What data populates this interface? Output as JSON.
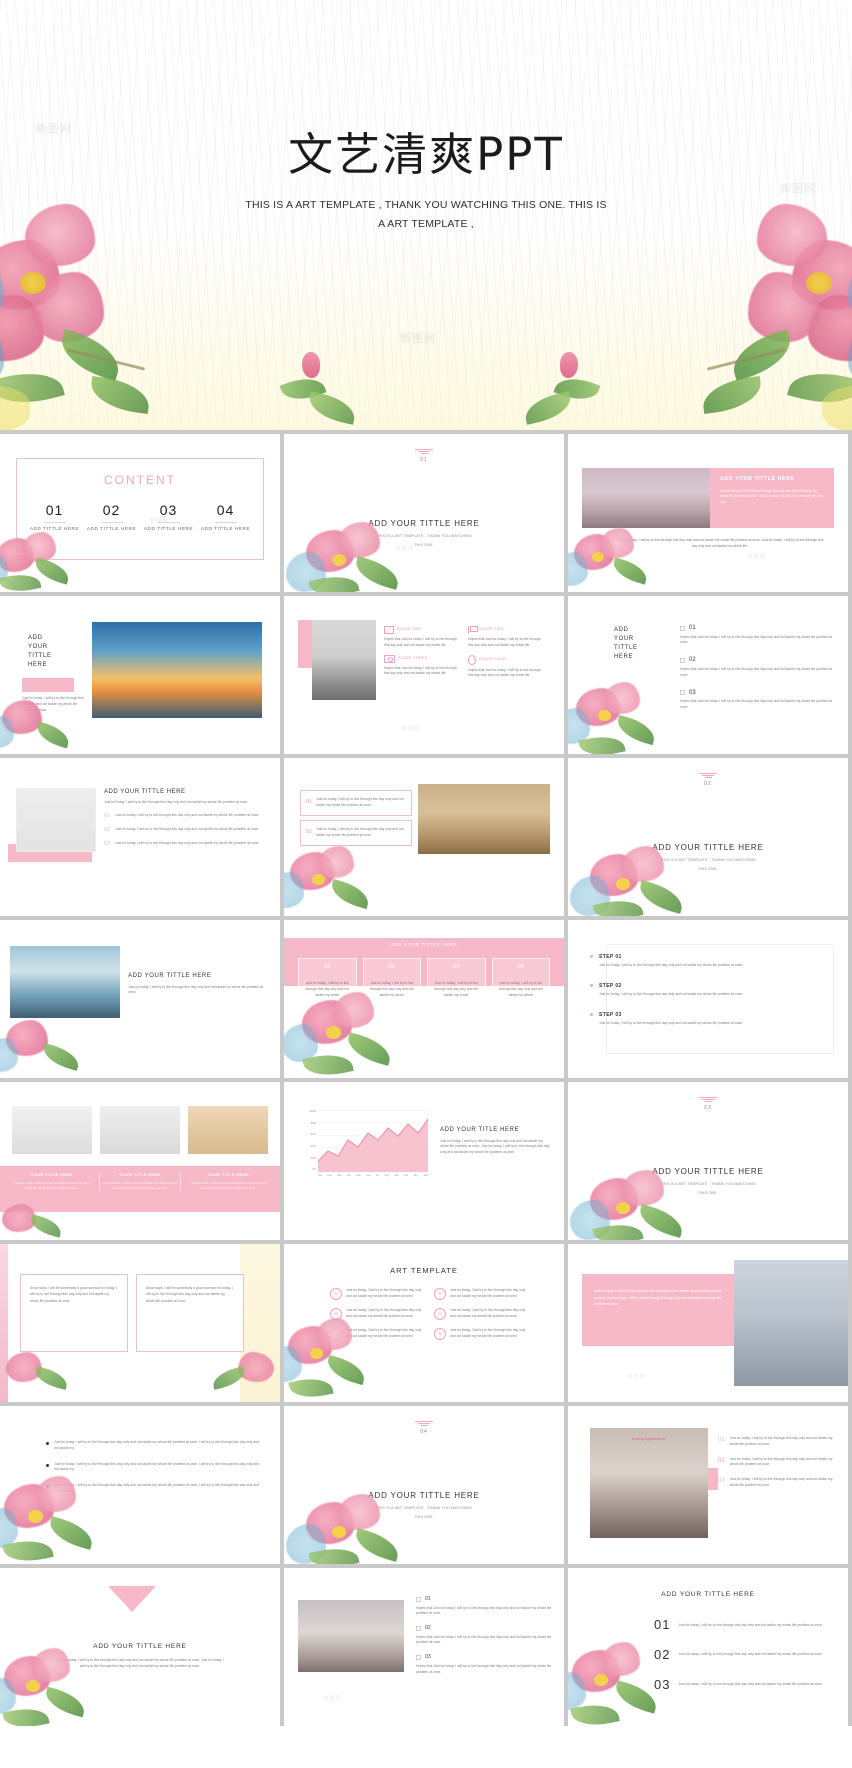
{
  "cover": {
    "title": "文艺清爽PPT",
    "subtitle_line1": "THIS IS A ART TEMPLATE , THANK YOU WATCHING THIS ONE. THIS IS",
    "subtitle_line2": "A ART TEMPLATE ,",
    "watermark": "新图网"
  },
  "common": {
    "body_short": "Just for today, I will try to live through this day only and not tackle my whole life problem at once.",
    "body_long": "Just for today, I will try to live through this day only and not tackle my whole life problem at once. Just for today, I will try to live through this day only and not tackle my whole life.",
    "body_tiny": "Just for today, I will try to live through this day only and not tackle my whole",
    "hope_text": "Hopes that Just for today, I will try to live through this day only and not tackle my whole life problem at once.",
    "title_default": "ADD  YOUR TITTLE HERE",
    "subtitle_default": "THIS IS A ART TEMPLATE ,  THANK YOU WATCHING THIS ONE",
    "add_title_here": "ADD TITTLE HERE",
    "accent_pink": "#f7b9c8",
    "accent_pink_text": "#f29ab0"
  },
  "slides": [
    {
      "id": "content-overview",
      "heading": "CONTENT",
      "numbers": [
        "01",
        "02",
        "03",
        "04"
      ],
      "labels": [
        "ADD TITTLE HERE",
        "ADD TITTLE HERE",
        "ADD TITTLE HERE",
        "ADD TITTLE HERE"
      ]
    },
    {
      "id": "section-01",
      "section_number": "01",
      "title": "ADD  YOUR TITTLE HERE",
      "subtitle_line1": "THIS IS A ART TEMPLATE ,  THANK YOU WATCHING",
      "subtitle_line2": "THIS ONE."
    },
    {
      "id": "photo-right-pink-panel",
      "panel_title": "ADD YOUR TITTLE HERE",
      "panel_body": "Just for today, I will try to live through this day only and not tackle my whole life problem at once. Just for today, I will try to live through this day only.",
      "caption": "Just for today, I will try to live through this day only and not tackle my whole life problem at once. Just for today, I will try to live through this day only and not tackle my whole life."
    },
    {
      "id": "photo-left-title",
      "title_lines": [
        "ADD",
        "YOUR",
        "TITTLE",
        "HERE"
      ],
      "body": "Just for today, I will try to live through this day only and not tackle my whole life problem at once."
    },
    {
      "id": "four-stage-icons",
      "stages": [
        {
          "label": "STAGE ONE",
          "icon": "envelope-icon",
          "body": "Hopes that Just for today, I will try to live through this day only and not tackle my whole life."
        },
        {
          "label": "STAGE TWO",
          "icon": "flag-icon",
          "body": "Hopes that Just for today, I will try to live through this day only and not tackle my whole life."
        },
        {
          "label": "STAGE THREE",
          "icon": "camera-icon",
          "body": "Hopes that Just for today, I will try to live through this day only and not tackle my whole life."
        },
        {
          "label": "STAGE FOUR",
          "icon": "pin-icon",
          "body": "Hopes that Just for today, I will try to live through this day only and not tackle my whole life."
        }
      ]
    },
    {
      "id": "checklist-three",
      "title_lines": [
        "ADD",
        "YOUR",
        "TITTLE",
        "HERE"
      ],
      "items": [
        {
          "num": "01",
          "body": "Hopes that Just for today, I will try to live through this day only and not tackle my whole life problem at once."
        },
        {
          "num": "02",
          "body": "Hopes that Just for today, I will try to live through this day only and not tackle my whole life problem at once."
        },
        {
          "num": "03",
          "body": "Hopes that Just for today, I will try to live through this day only and not tackle my whole life problem at once."
        }
      ]
    },
    {
      "id": "swan-numbered-list",
      "title": "ADD YOUR TITTLE  HERE",
      "subtitle": "Just for today, I will try to live through this day only and not tackle my whole life problem at once.",
      "items": [
        {
          "num": "01",
          "body": "Just for today, I will try to live through this day only and not tackle my whole life problem at once."
        },
        {
          "num": "02",
          "body": "Just for today, I will try to live through this day only and not tackle my whole life problem at once."
        },
        {
          "num": "03",
          "body": "Just for today, I will try to live through this day only and not tackle my whole life problem at once."
        }
      ]
    },
    {
      "id": "zebra-two-callouts",
      "callouts": [
        {
          "num": "01",
          "body": "Just for today, I will try to live through this day only and not tackle my whole life problem at once."
        },
        {
          "num": "02",
          "body": "Just for today, I will try to live through this day only and not tackle my whole life problem at once."
        }
      ]
    },
    {
      "id": "section-02",
      "section_number": "02",
      "title": "ADD  YOUR TITTLE HERE",
      "subtitle_line1": "THIS IS A ART TEMPLATE ,  THANK YOU WATCHING",
      "subtitle_line2": "THIS ONE."
    },
    {
      "id": "lake-photo-title",
      "title": "ADD YOUR TITTLE HERE",
      "body": "Just for today, I will try to live through this day only and not tackle my whole life problem at once."
    },
    {
      "id": "four-column-pink-table",
      "header_title": "ADD YOUR TITTLE HERE",
      "columns": [
        "01",
        "02",
        "03",
        "04"
      ],
      "cells": [
        "Just for today, I will try to live through this day only and not tackle my whole",
        "Just for today, I will try to live through this day only and not tackle my whole",
        "Just for today, I will try to live through this day only and not tackle my whole",
        "Just for today, I will try to live through this day only and not tackle my whole"
      ]
    },
    {
      "id": "three-steps",
      "steps": [
        {
          "label": "STEP 01",
          "body": "Just for today, I will try to live through this day only and not tackle my whole life problem at once."
        },
        {
          "label": "STEP 02",
          "body": "Just for today, I will try to live through this day only and not tackle my whole life problem at once."
        },
        {
          "label": "STEP 03",
          "body": "Just for today, I will try to live through this day only and not tackle my whole life problem at once."
        }
      ]
    },
    {
      "id": "three-photos-pink-captions",
      "cards": [
        {
          "title": "YOUR TITLE HERE",
          "body": "Just for today, I will try to live through this day only and not tackle my whole life problem at once."
        },
        {
          "title": "YOUR TITLE HERE",
          "body": "Just for today, I will try to live through this day only and not tackle my whole life problem at once."
        },
        {
          "title": "YOUR TITLE HERE",
          "body": "Just for today, I will try to live through this day only and not tackle my whole life problem at once."
        }
      ]
    },
    {
      "id": "area-chart-slide",
      "title": "ADD YOUR TITLE HERE",
      "body": "Just for today, I will try to live through this day only and not tackle my whole life problem at once. Just for today, I will try to live through this day only and not tackle my whole life problem at once.",
      "chart_data": {
        "type": "area",
        "title": "",
        "xlabel": "",
        "ylabel": "",
        "categories": [
          "Jan",
          "Feb",
          "Mar",
          "Apr",
          "May",
          "Jun",
          "Jul",
          "Aug",
          "Sep",
          "Oct",
          "Nov",
          "Dec"
        ],
        "tick_labels_y": [
          "100%",
          "80%",
          "60%",
          "40%",
          "20%",
          "0%"
        ],
        "ylim": [
          0,
          100
        ],
        "grid": true,
        "legend": "none",
        "series": [
          {
            "name": "Series 1",
            "values": [
              18,
              34,
              26,
              52,
              40,
              62,
              48,
              70,
              55,
              78,
              60,
              84
            ]
          }
        ]
      }
    },
    {
      "id": "section-03",
      "section_number": "03",
      "title": "ADD  YOUR TITTLE HERE",
      "subtitle_line1": "THIS IS A ART TEMPLATE ,  THANK YOU WATCHING",
      "subtitle_line2": "THIS ONE."
    },
    {
      "id": "two-quote-cards",
      "cards": [
        {
          "body": "Show says, I will be somebody a good survivor for today. I will try to live through this day only and not tackle my whole life problem at once."
        },
        {
          "body": "Show says, I will be somebody a good survivor for today. I will try to live through this day only and not tackle my whole life problem at once."
        }
      ]
    },
    {
      "id": "art-template-six-items",
      "title": "ART TEMPLATE",
      "items": [
        {
          "num": "01",
          "body": "Just for today, I will try to live through this day only and not tackle my whole life problem at once"
        },
        {
          "num": "02",
          "body": "Just for today, I will try to live through this day only and not tackle my whole life problem at once"
        },
        {
          "num": "03",
          "body": "Just for today, I will try to live through this day only and not tackle my whole life problem at once"
        },
        {
          "num": "04",
          "body": "Just for today, I will try to live through this day only and not tackle my whole life problem at once"
        },
        {
          "num": "05",
          "body": "Just for today, I will try to live through this day only and not tackle my whole life problem at once"
        },
        {
          "num": "06",
          "body": "Just for today, I will try to live through this day only and not tackle my whole life problem at once"
        }
      ]
    },
    {
      "id": "glass-building-pink-panel",
      "body": "Just for today, I will try to live through this day only and not tackle my whole life problem at once. Just for today, I will try to live through this day only and not tackle my whole life problem at once."
    },
    {
      "id": "bullet-list-slide",
      "bullets": [
        "Just for today, I will try to live through this day only and not tackle my whole life problem at once. I will try to live through this day only and not tackle my.",
        "Just for today, I will try to live through this day only and not tackle my whole life problem at once. I will try to live through this day only and not tackle my.",
        "Just for today, I will try to live through this day only and not tackle my whole life problem at once. I will try to live through this day only and not tackle my."
      ]
    },
    {
      "id": "section-04",
      "section_number": "04",
      "title": "ADD  YOUR TITTLE HERE",
      "subtitle_line1": "THIS IS A ART TEMPLATE ,  THANK YOU WATCHING",
      "subtitle_line2": "THIS ONE."
    },
    {
      "id": "street-photo-numbered",
      "photo_caption": "Danqingbaobao",
      "items": [
        {
          "num": "01",
          "body": "Just for today, I will try to live through this day only and not tackle my whole life problem at once."
        },
        {
          "num": "02",
          "body": "Just for today, I will try to live through this day only and not tackle my whole life problem at once."
        },
        {
          "num": "03",
          "body": "Just for today, I will try to live through this day only and not tackle my whole life problem at once."
        }
      ]
    },
    {
      "id": "triangle-title-slide",
      "title": "ADD YOUR TITTLE  HERE",
      "body": "Just for today, I will try to live through this day only and not tackle my whole life problem at once. Just for today, I will try to live through this day only and not tackle my whole life problem at once."
    },
    {
      "id": "bridge-photo-numbered",
      "items": [
        {
          "num": "01",
          "body": "Hopes that Just for today, I will try to live through this day only and not tackle my whole life problem at once."
        },
        {
          "num": "02",
          "body": "Hopes that Just for today, I will try to live through this day only and not tackle my whole life problem at once."
        },
        {
          "num": "03",
          "body": "Hopes that Just for today, I will try to live through this day only and not tackle my whole life problem at once."
        }
      ]
    },
    {
      "id": "big-numbers-list",
      "title": "ADD YOUR TITTLE  HERE",
      "items": [
        {
          "num": "01",
          "body": "Just for today, I will try to live through this day only and not tackle my whole life problem at once."
        },
        {
          "num": "02",
          "body": "Just for today, I will try to live through this day only and not tackle my whole life problem at once."
        },
        {
          "num": "03",
          "body": "Just for today, I will try to live through this day only and not tackle my whole life problem at once."
        }
      ]
    }
  ]
}
